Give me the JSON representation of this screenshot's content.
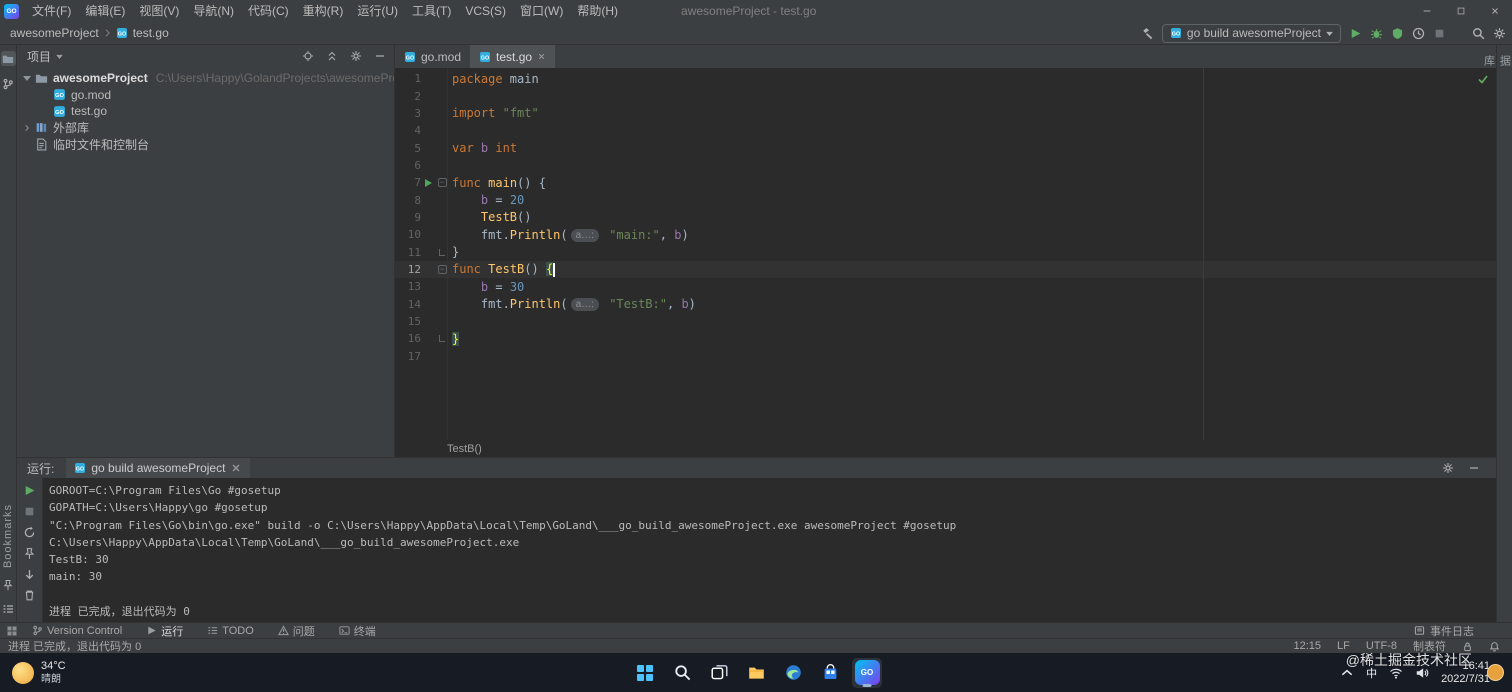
{
  "colors": {
    "panel_bg": "#3c3f41",
    "editor_bg": "#2b2b2b",
    "accent_green": "#5fad65",
    "keyword": "#cc7832",
    "string": "#6a8759",
    "function": "#ffc66b",
    "number": "#6897bb",
    "variable": "#9876aa"
  },
  "titlebar": {
    "logo": "GO",
    "menus": [
      "文件(F)",
      "编辑(E)",
      "视图(V)",
      "导航(N)",
      "代码(C)",
      "重构(R)",
      "运行(U)",
      "工具(T)",
      "VCS(S)",
      "窗口(W)",
      "帮助(H)"
    ],
    "title": "awesomeProject - test.go"
  },
  "navbar": {
    "breadcrumbs": [
      "awesomeProject",
      "test.go"
    ],
    "run_config": "go build awesomeProject"
  },
  "stripes": {
    "left_bottom_label": "Bookmarks",
    "right_top_label": "数据库"
  },
  "project_panel": {
    "header": "项目",
    "tree": [
      {
        "label": "awesomeProject",
        "hint": "C:\\Users\\Happy\\GolandProjects\\awesomeProject",
        "icon": "folder",
        "level": 0,
        "arrow": "down",
        "bold": true
      },
      {
        "label": "go.mod",
        "icon": "gofile",
        "level": 1
      },
      {
        "label": "test.go",
        "icon": "gofile",
        "level": 1
      },
      {
        "label": "外部库",
        "icon": "lib",
        "level": 0,
        "arrow": "right"
      },
      {
        "label": "临时文件和控制台",
        "icon": "scratch",
        "level": 0
      }
    ]
  },
  "editor": {
    "tabs": [
      {
        "label": "go.mod",
        "active": false
      },
      {
        "label": "test.go",
        "active": true
      }
    ],
    "breadcrumb": "TestB()",
    "code": [
      {
        "n": 1,
        "t": [
          [
            "kw",
            "package"
          ],
          [
            "pl",
            " main"
          ]
        ]
      },
      {
        "n": 2,
        "t": []
      },
      {
        "n": 3,
        "t": [
          [
            "kw",
            "import"
          ],
          [
            "pl",
            " "
          ],
          [
            "str",
            "\"fmt\""
          ]
        ]
      },
      {
        "n": 4,
        "t": []
      },
      {
        "n": 5,
        "t": [
          [
            "kw",
            "var"
          ],
          [
            "pl",
            " "
          ],
          [
            "vr",
            "b"
          ],
          [
            "pl",
            " "
          ],
          [
            "kw",
            "int"
          ]
        ]
      },
      {
        "n": 6,
        "t": []
      },
      {
        "n": 7,
        "run": true,
        "fold": "start",
        "t": [
          [
            "kw",
            "func"
          ],
          [
            "pl",
            " "
          ],
          [
            "fn",
            "main"
          ],
          [
            "pl",
            "() {"
          ]
        ]
      },
      {
        "n": 8,
        "t": [
          [
            "pl",
            "    "
          ],
          [
            "vr",
            "b"
          ],
          [
            "pl",
            " = "
          ],
          [
            "num",
            "20"
          ]
        ]
      },
      {
        "n": 9,
        "t": [
          [
            "pl",
            "    "
          ],
          [
            "fn",
            "TestB"
          ],
          [
            "pl",
            "()"
          ]
        ]
      },
      {
        "n": 10,
        "t": [
          [
            "pl",
            "    fmt."
          ],
          [
            "fn",
            "Println"
          ],
          [
            "pl",
            "("
          ],
          [
            "hint",
            "a…:"
          ],
          [
            "pl",
            " "
          ],
          [
            "str",
            "\"main:\""
          ],
          [
            "pl",
            ", "
          ],
          [
            "vr",
            "b"
          ],
          [
            "pl",
            ")"
          ]
        ]
      },
      {
        "n": 11,
        "fold": "end",
        "t": [
          [
            "pl",
            "}"
          ]
        ]
      },
      {
        "n": 12,
        "current": true,
        "caret": true,
        "fold": "start",
        "t": [
          [
            "kw",
            "func"
          ],
          [
            "pl",
            " "
          ],
          [
            "fn",
            "TestB"
          ],
          [
            "pl",
            "() "
          ],
          [
            "brc",
            "{"
          ]
        ]
      },
      {
        "n": 13,
        "t": [
          [
            "pl",
            "    "
          ],
          [
            "vr",
            "b"
          ],
          [
            "pl",
            " = "
          ],
          [
            "num",
            "30"
          ]
        ]
      },
      {
        "n": 14,
        "t": [
          [
            "pl",
            "    fmt."
          ],
          [
            "fn",
            "Println"
          ],
          [
            "pl",
            "("
          ],
          [
            "hint",
            "a…:"
          ],
          [
            "pl",
            " "
          ],
          [
            "str",
            "\"TestB:\""
          ],
          [
            "pl",
            ", "
          ],
          [
            "vr",
            "b"
          ],
          [
            "pl",
            ")"
          ]
        ]
      },
      {
        "n": 15,
        "t": []
      },
      {
        "n": 16,
        "fold": "end",
        "t": [
          [
            "brc",
            "}"
          ]
        ]
      },
      {
        "n": 17,
        "t": []
      }
    ]
  },
  "run_panel": {
    "label": "运行:",
    "tab": "go build awesomeProject",
    "toolbar_icons": [
      "rerun",
      "stop",
      "restart",
      "pin",
      "scroll-down",
      "clear"
    ],
    "console": [
      "GOROOT=C:\\Program Files\\Go #gosetup",
      "GOPATH=C:\\Users\\Happy\\go #gosetup",
      "\"C:\\Program Files\\Go\\bin\\go.exe\" build -o C:\\Users\\Happy\\AppData\\Local\\Temp\\GoLand\\___go_build_awesomeProject.exe awesomeProject #gosetup",
      "C:\\Users\\Happy\\AppData\\Local\\Temp\\GoLand\\___go_build_awesomeProject.exe",
      "TestB: 30",
      "main: 30",
      "",
      "进程 已完成，退出代码为 0"
    ]
  },
  "bottom_bar": {
    "items": [
      {
        "label": "Version Control",
        "icon": "branch",
        "name": "version-control"
      },
      {
        "label": "运行",
        "icon": "play",
        "name": "run",
        "active": true
      },
      {
        "label": "TODO",
        "icon": "todo",
        "name": "todo"
      },
      {
        "label": "问题",
        "icon": "warn",
        "name": "problems"
      },
      {
        "label": "终端",
        "icon": "terminal",
        "name": "terminal"
      }
    ],
    "right_label": "事件日志"
  },
  "status_bar": {
    "message": "进程 已完成，退出代码为 0",
    "caret_position": "12:15",
    "line_separator": "LF",
    "encoding": "UTF-8",
    "indent": "制表符"
  },
  "taskbar": {
    "weather_temp": "34°C",
    "weather_desc": "晴朗",
    "apps": [
      "start",
      "search",
      "taskview",
      "explorer",
      "edge",
      "store",
      "goland"
    ],
    "tray_ime": "中",
    "time": "16:41",
    "date": "2022/7/31"
  },
  "watermark": "@稀土掘金技术社区"
}
